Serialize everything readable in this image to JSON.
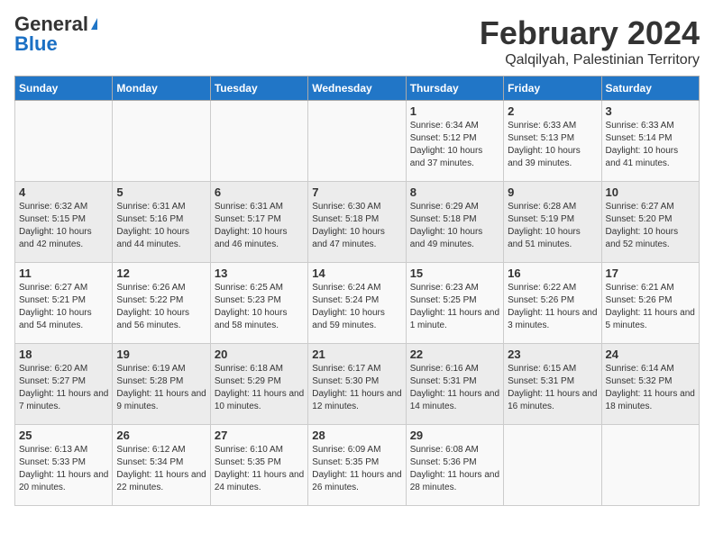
{
  "header": {
    "logo_general": "General",
    "logo_blue": "Blue",
    "month_title": "February 2024",
    "location": "Qalqilyah, Palestinian Territory"
  },
  "weekdays": [
    "Sunday",
    "Monday",
    "Tuesday",
    "Wednesday",
    "Thursday",
    "Friday",
    "Saturday"
  ],
  "weeks": [
    [
      {
        "day": "",
        "detail": ""
      },
      {
        "day": "",
        "detail": ""
      },
      {
        "day": "",
        "detail": ""
      },
      {
        "day": "",
        "detail": ""
      },
      {
        "day": "1",
        "detail": "Sunrise: 6:34 AM\nSunset: 5:12 PM\nDaylight: 10 hours\nand 37 minutes."
      },
      {
        "day": "2",
        "detail": "Sunrise: 6:33 AM\nSunset: 5:13 PM\nDaylight: 10 hours\nand 39 minutes."
      },
      {
        "day": "3",
        "detail": "Sunrise: 6:33 AM\nSunset: 5:14 PM\nDaylight: 10 hours\nand 41 minutes."
      }
    ],
    [
      {
        "day": "4",
        "detail": "Sunrise: 6:32 AM\nSunset: 5:15 PM\nDaylight: 10 hours\nand 42 minutes."
      },
      {
        "day": "5",
        "detail": "Sunrise: 6:31 AM\nSunset: 5:16 PM\nDaylight: 10 hours\nand 44 minutes."
      },
      {
        "day": "6",
        "detail": "Sunrise: 6:31 AM\nSunset: 5:17 PM\nDaylight: 10 hours\nand 46 minutes."
      },
      {
        "day": "7",
        "detail": "Sunrise: 6:30 AM\nSunset: 5:18 PM\nDaylight: 10 hours\nand 47 minutes."
      },
      {
        "day": "8",
        "detail": "Sunrise: 6:29 AM\nSunset: 5:18 PM\nDaylight: 10 hours\nand 49 minutes."
      },
      {
        "day": "9",
        "detail": "Sunrise: 6:28 AM\nSunset: 5:19 PM\nDaylight: 10 hours\nand 51 minutes."
      },
      {
        "day": "10",
        "detail": "Sunrise: 6:27 AM\nSunset: 5:20 PM\nDaylight: 10 hours\nand 52 minutes."
      }
    ],
    [
      {
        "day": "11",
        "detail": "Sunrise: 6:27 AM\nSunset: 5:21 PM\nDaylight: 10 hours\nand 54 minutes."
      },
      {
        "day": "12",
        "detail": "Sunrise: 6:26 AM\nSunset: 5:22 PM\nDaylight: 10 hours\nand 56 minutes."
      },
      {
        "day": "13",
        "detail": "Sunrise: 6:25 AM\nSunset: 5:23 PM\nDaylight: 10 hours\nand 58 minutes."
      },
      {
        "day": "14",
        "detail": "Sunrise: 6:24 AM\nSunset: 5:24 PM\nDaylight: 10 hours\nand 59 minutes."
      },
      {
        "day": "15",
        "detail": "Sunrise: 6:23 AM\nSunset: 5:25 PM\nDaylight: 11 hours\nand 1 minute."
      },
      {
        "day": "16",
        "detail": "Sunrise: 6:22 AM\nSunset: 5:26 PM\nDaylight: 11 hours\nand 3 minutes."
      },
      {
        "day": "17",
        "detail": "Sunrise: 6:21 AM\nSunset: 5:26 PM\nDaylight: 11 hours\nand 5 minutes."
      }
    ],
    [
      {
        "day": "18",
        "detail": "Sunrise: 6:20 AM\nSunset: 5:27 PM\nDaylight: 11 hours\nand 7 minutes."
      },
      {
        "day": "19",
        "detail": "Sunrise: 6:19 AM\nSunset: 5:28 PM\nDaylight: 11 hours\nand 9 minutes."
      },
      {
        "day": "20",
        "detail": "Sunrise: 6:18 AM\nSunset: 5:29 PM\nDaylight: 11 hours\nand 10 minutes."
      },
      {
        "day": "21",
        "detail": "Sunrise: 6:17 AM\nSunset: 5:30 PM\nDaylight: 11 hours\nand 12 minutes."
      },
      {
        "day": "22",
        "detail": "Sunrise: 6:16 AM\nSunset: 5:31 PM\nDaylight: 11 hours\nand 14 minutes."
      },
      {
        "day": "23",
        "detail": "Sunrise: 6:15 AM\nSunset: 5:31 PM\nDaylight: 11 hours\nand 16 minutes."
      },
      {
        "day": "24",
        "detail": "Sunrise: 6:14 AM\nSunset: 5:32 PM\nDaylight: 11 hours\nand 18 minutes."
      }
    ],
    [
      {
        "day": "25",
        "detail": "Sunrise: 6:13 AM\nSunset: 5:33 PM\nDaylight: 11 hours\nand 20 minutes."
      },
      {
        "day": "26",
        "detail": "Sunrise: 6:12 AM\nSunset: 5:34 PM\nDaylight: 11 hours\nand 22 minutes."
      },
      {
        "day": "27",
        "detail": "Sunrise: 6:10 AM\nSunset: 5:35 PM\nDaylight: 11 hours\nand 24 minutes."
      },
      {
        "day": "28",
        "detail": "Sunrise: 6:09 AM\nSunset: 5:35 PM\nDaylight: 11 hours\nand 26 minutes."
      },
      {
        "day": "29",
        "detail": "Sunrise: 6:08 AM\nSunset: 5:36 PM\nDaylight: 11 hours\nand 28 minutes."
      },
      {
        "day": "",
        "detail": ""
      },
      {
        "day": "",
        "detail": ""
      }
    ]
  ]
}
